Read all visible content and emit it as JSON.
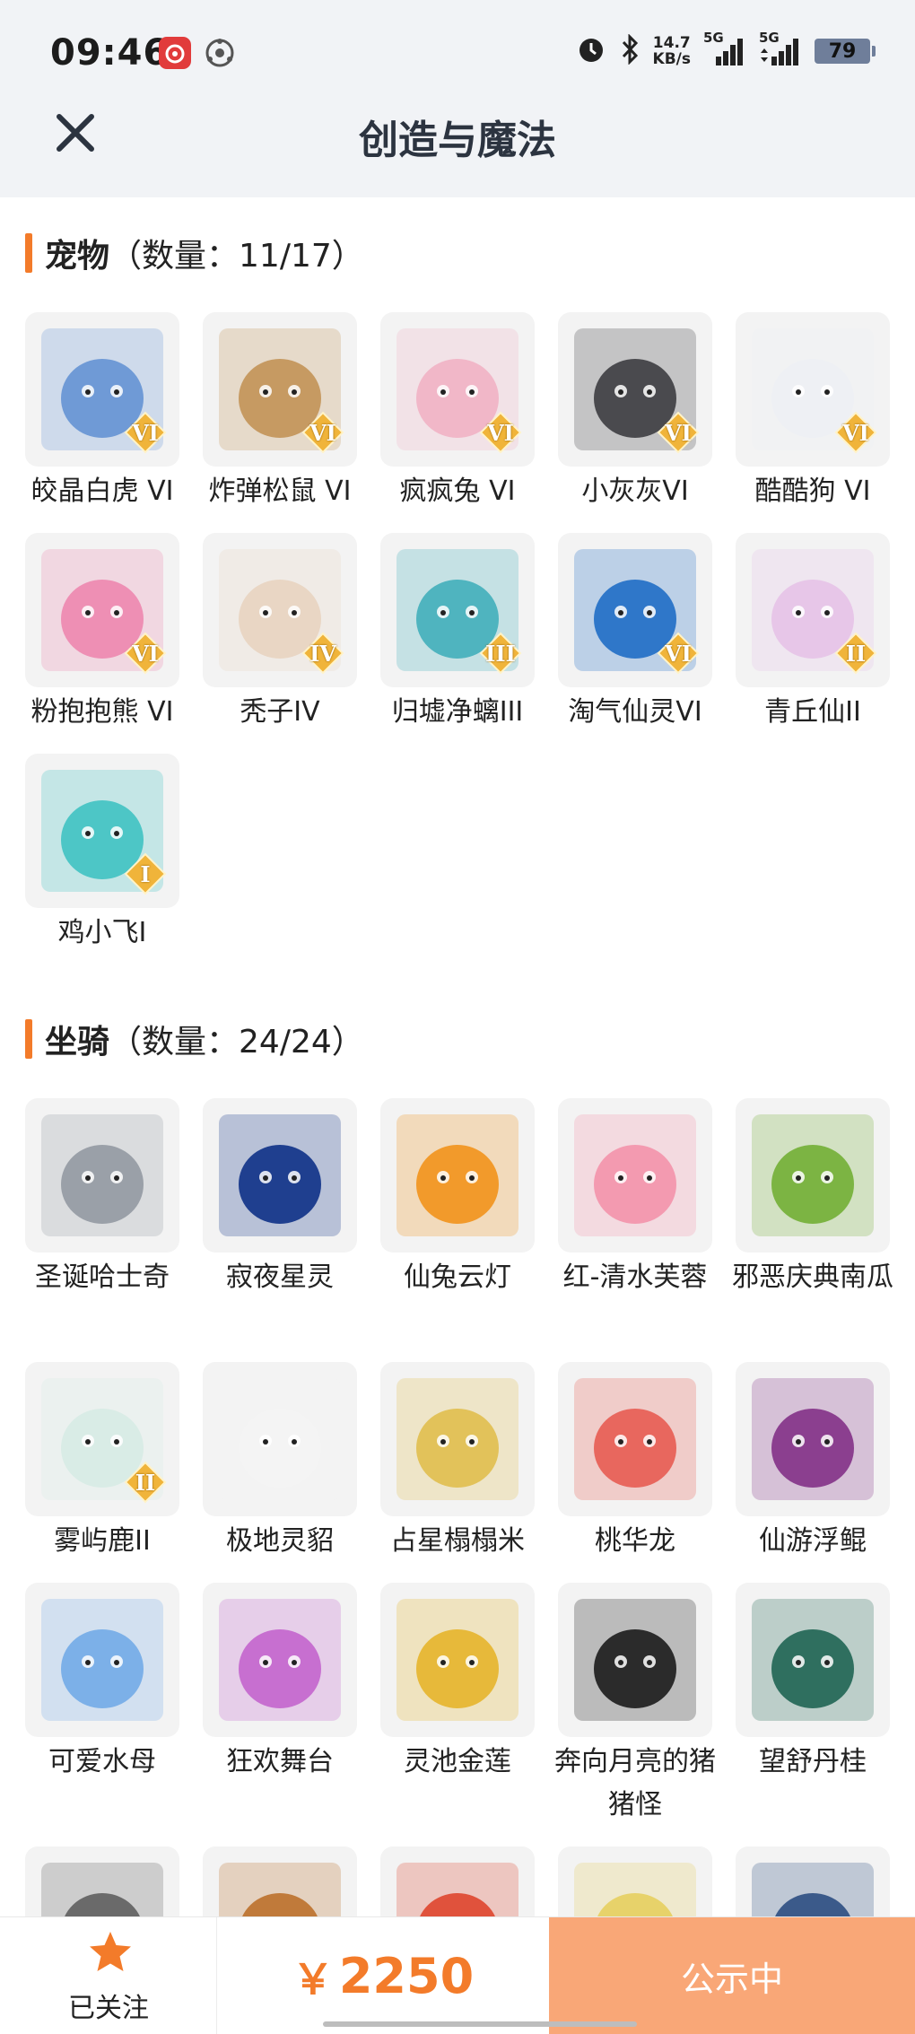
{
  "status_bar": {
    "time": "09:46",
    "net_speed_value": "14.7",
    "net_speed_unit": "KB/s",
    "net1": "5G",
    "net2": "5G",
    "battery": "79"
  },
  "header": {
    "title": "创造与魔法"
  },
  "pets": {
    "name": "宠物",
    "count": "（数量：11/17）",
    "items": [
      {
        "label": "皎晶白虎 VI",
        "badge": "VI",
        "color": "#6f9ad6"
      },
      {
        "label": "炸弹松鼠 VI",
        "badge": "VI",
        "color": "#c69a62"
      },
      {
        "label": "疯疯兔 VI",
        "badge": "VI",
        "color": "#f1b7c8"
      },
      {
        "label": "小灰灰VI",
        "badge": "VI",
        "color": "#4a4a4e"
      },
      {
        "label": "酷酷狗 VI",
        "badge": "VI",
        "color": "#eef0f4"
      },
      {
        "label": "粉抱抱熊 VI",
        "badge": "VI",
        "color": "#ee8fb4"
      },
      {
        "label": "秃子IV",
        "badge": "IV",
        "color": "#e9d6c4"
      },
      {
        "label": "归墟净螭III",
        "badge": "III",
        "color": "#4fb4bf"
      },
      {
        "label": "淘气仙灵VI",
        "badge": "VI",
        "color": "#2f77c9"
      },
      {
        "label": "青丘仙II",
        "badge": "II",
        "color": "#e7c6e8"
      },
      {
        "label": "鸡小飞I",
        "badge": "I",
        "color": "#4dc6c6"
      }
    ]
  },
  "mounts": {
    "name": "坐骑",
    "count": "（数量：24/24）",
    "items": [
      {
        "label": "圣诞哈士奇",
        "badge": "",
        "color": "#9aa0a8"
      },
      {
        "label": "寂夜星灵",
        "badge": "",
        "color": "#1f3f8f"
      },
      {
        "label": "仙兔云灯",
        "badge": "",
        "color": "#f29a2b"
      },
      {
        "label": "红-清水芙蓉",
        "badge": "",
        "color": "#f39ab0"
      },
      {
        "label": "邪恶庆典南瓜",
        "badge": "",
        "color": "#7cb443"
      },
      {
        "label": "雾屿鹿II",
        "badge": "II",
        "color": "#d9ece6"
      },
      {
        "label": "极地灵貂",
        "badge": "",
        "color": "#f4f4f4"
      },
      {
        "label": "占星榻榻米",
        "badge": "",
        "color": "#e2c25a"
      },
      {
        "label": "桃华龙",
        "badge": "",
        "color": "#e8675e"
      },
      {
        "label": "仙游浮鲲",
        "badge": "",
        "color": "#8b3f8f"
      },
      {
        "label": "可爱水母",
        "badge": "",
        "color": "#7cb0e8"
      },
      {
        "label": "狂欢舞台",
        "badge": "",
        "color": "#c76fd0"
      },
      {
        "label": "灵池金莲",
        "badge": "",
        "color": "#e7b93a"
      },
      {
        "label": "奔向月亮的猪猪怪",
        "badge": "",
        "color": "#2b2b2b"
      },
      {
        "label": "望舒丹桂",
        "badge": "",
        "color": "#2f6f5f"
      },
      {
        "label": "",
        "badge": "",
        "color": "#6a6a6a"
      },
      {
        "label": "",
        "badge": "",
        "color": "#c07a3a"
      },
      {
        "label": "",
        "badge": "",
        "color": "#e0523c"
      },
      {
        "label": "",
        "badge": "",
        "color": "#e7d26a"
      },
      {
        "label": "",
        "badge": "",
        "color": "#3b5a8a"
      }
    ]
  },
  "bottom": {
    "follow_label": "已关注",
    "currency": "￥",
    "price": "2250",
    "status_label": "公示中",
    "accent": "#f37b2a"
  }
}
